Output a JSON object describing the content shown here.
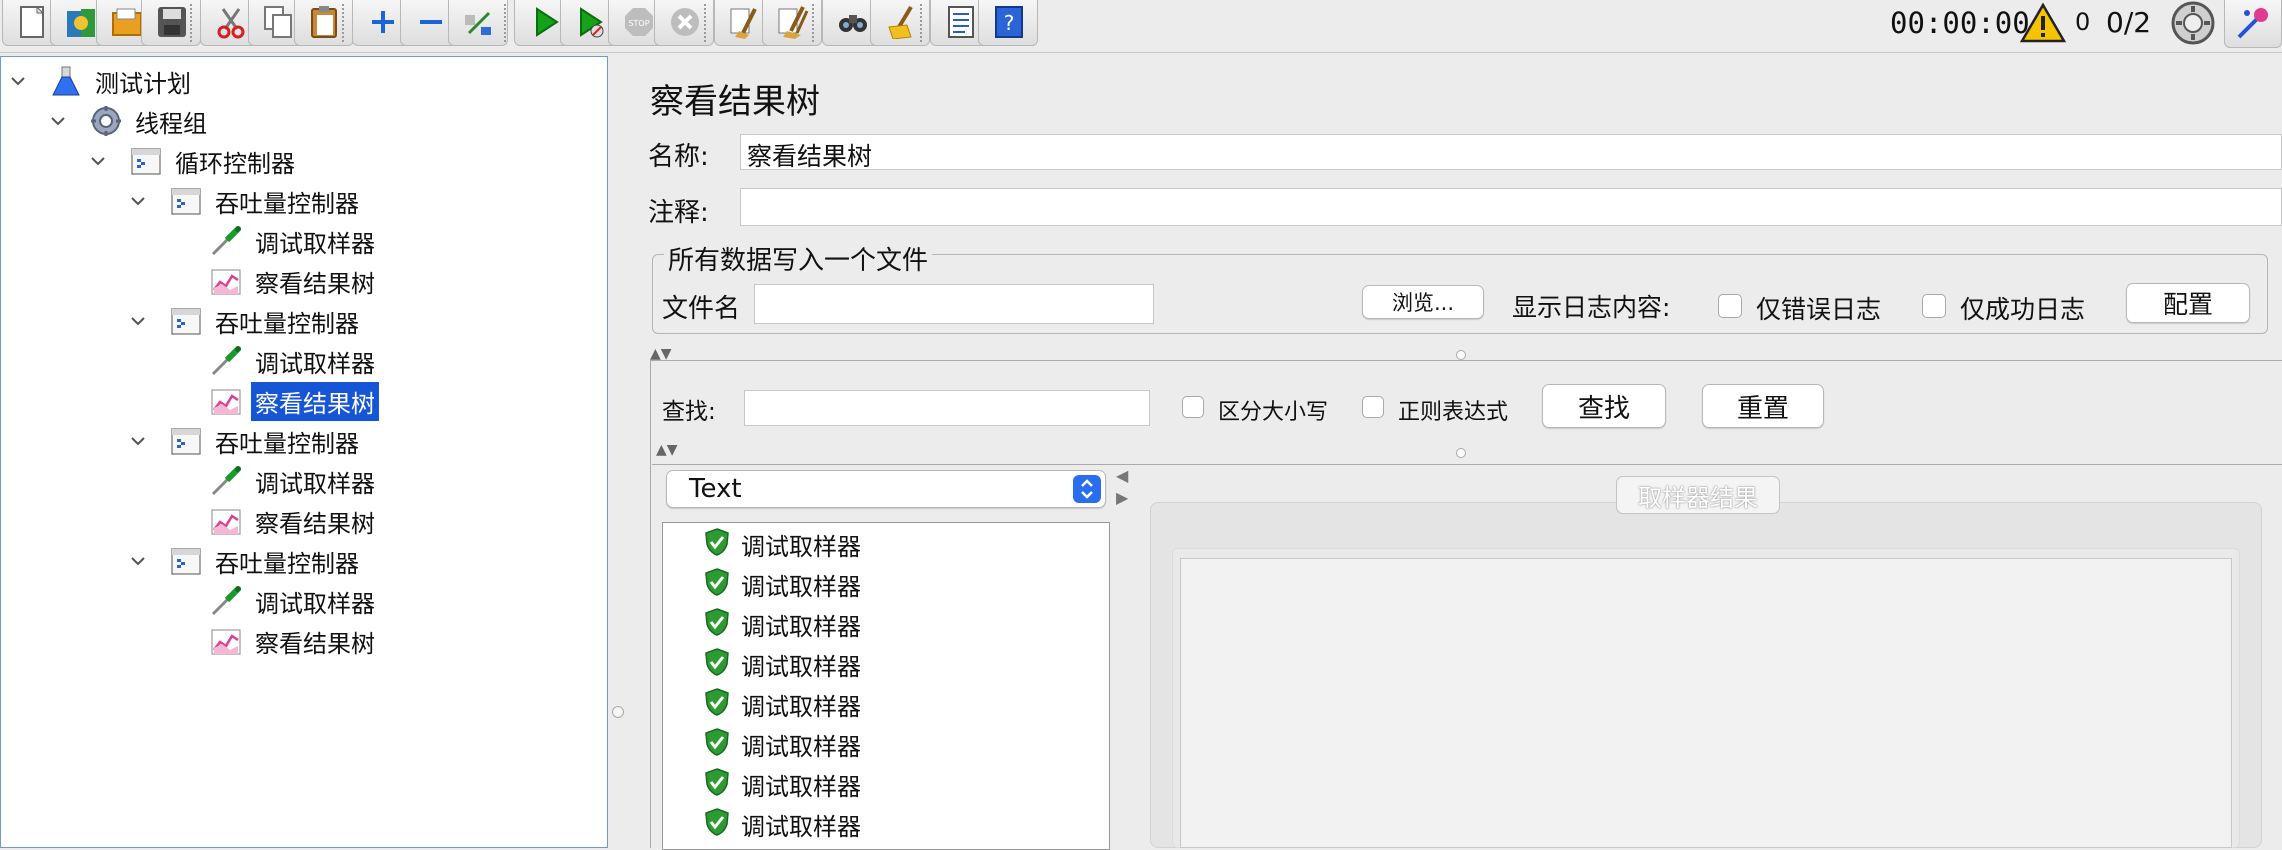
{
  "toolbar": {
    "buttons": [
      {
        "name": "new-icon"
      },
      {
        "name": "templates-icon"
      },
      {
        "name": "open-icon"
      },
      {
        "name": "save-icon"
      },
      {
        "name": "cut-icon"
      },
      {
        "name": "copy-icon"
      },
      {
        "name": "paste-icon"
      },
      {
        "name": "expand-icon"
      },
      {
        "name": "collapse-icon"
      },
      {
        "name": "toggle-icon"
      },
      {
        "name": "start-icon"
      },
      {
        "name": "start-no-pauses-icon"
      },
      {
        "name": "stop-icon"
      },
      {
        "name": "shutdown-icon"
      },
      {
        "name": "clear-icon"
      },
      {
        "name": "clear-all-icon"
      },
      {
        "name": "search-icon"
      },
      {
        "name": "reset-search-icon"
      },
      {
        "name": "function-helper-icon"
      },
      {
        "name": "help-icon"
      }
    ],
    "elapsed_time": "00:00:00",
    "warning_count": "0",
    "active_threads": "0/2"
  },
  "tree": {
    "nodes": [
      {
        "label": "测试计划",
        "icon": "test-plan-icon",
        "level": 0,
        "expanded": true
      },
      {
        "label": "线程组",
        "icon": "thread-group-icon",
        "level": 1,
        "expanded": true
      },
      {
        "label": "循环控制器",
        "icon": "controller-icon",
        "level": 2,
        "expanded": true
      },
      {
        "label": "吞吐量控制器",
        "icon": "controller-icon",
        "level": 3,
        "expanded": true
      },
      {
        "label": "调试取样器",
        "icon": "sampler-icon",
        "level": 4
      },
      {
        "label": "察看结果树",
        "icon": "listener-icon",
        "level": 4
      },
      {
        "label": "吞吐量控制器",
        "icon": "controller-icon",
        "level": 3,
        "expanded": true
      },
      {
        "label": "调试取样器",
        "icon": "sampler-icon",
        "level": 4
      },
      {
        "label": "察看结果树",
        "icon": "listener-icon",
        "level": 4,
        "selected": true
      },
      {
        "label": "吞吐量控制器",
        "icon": "controller-icon",
        "level": 3,
        "expanded": true
      },
      {
        "label": "调试取样器",
        "icon": "sampler-icon",
        "level": 4
      },
      {
        "label": "察看结果树",
        "icon": "listener-icon",
        "level": 4
      },
      {
        "label": "吞吐量控制器",
        "icon": "controller-icon",
        "level": 3,
        "expanded": true
      },
      {
        "label": "调试取样器",
        "icon": "sampler-icon",
        "level": 4
      },
      {
        "label": "察看结果树",
        "icon": "listener-icon",
        "level": 4
      }
    ]
  },
  "panel": {
    "title": "察看结果树",
    "name_label": "名称:",
    "name_value": "察看结果树",
    "comment_label": "注释:",
    "comment_value": "",
    "file_group_title": "所有数据写入一个文件",
    "filename_label": "文件名",
    "filename_value": "",
    "browse_button": "浏览...",
    "log_content_label": "显示日志内容:",
    "errors_only_label": "仅错误日志",
    "success_only_label": "仅成功日志",
    "configure_button": "配置"
  },
  "search": {
    "label": "查找:",
    "value": "",
    "case_sensitive_label": "区分大小写",
    "regex_label": "正则表达式",
    "find_button": "查找",
    "reset_button": "重置"
  },
  "results": {
    "renderer": "Text",
    "items": [
      "调试取样器",
      "调试取样器",
      "调试取样器",
      "调试取样器",
      "调试取样器",
      "调试取样器",
      "调试取样器",
      "调试取样器"
    ],
    "sampler_result_tab": "取样器结果"
  },
  "colors": {
    "selection": "#1656d6",
    "success_shield": "#2e9a34",
    "select_arrow": "#2a6ef0"
  }
}
